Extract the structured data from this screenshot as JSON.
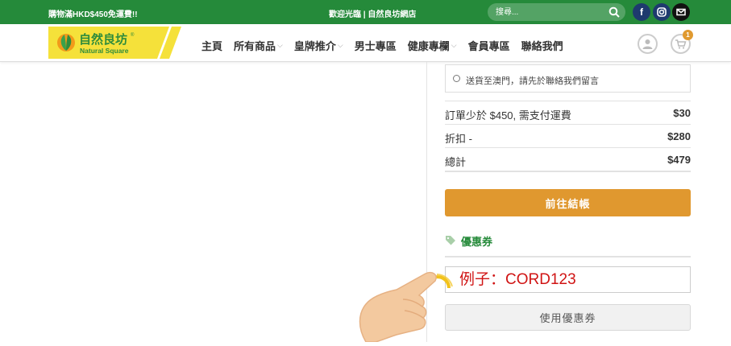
{
  "topbar": {
    "promo": "購物滿HKD$450免運費!!",
    "welcome": "歡迎光臨 | 自然良坊網店",
    "search_placeholder": "搜尋...",
    "search_icon": "search-icon",
    "social": [
      {
        "name": "facebook-icon",
        "glyph": "f",
        "color": "#1e3a6e"
      },
      {
        "name": "instagram-icon",
        "glyph": "◎",
        "color": "#1e3a6e"
      },
      {
        "name": "email-icon",
        "glyph": "✉",
        "color": "#111111"
      }
    ]
  },
  "logo": {
    "chinese": "自然良坊",
    "english": "Natural Square",
    "reg": "®"
  },
  "nav": {
    "items": [
      {
        "label": "主頁"
      },
      {
        "label": "所有商品",
        "dropdown": true
      },
      {
        "label": "皇牌推介",
        "dropdown": true
      },
      {
        "label": "男士專區"
      },
      {
        "label": "健康專欄",
        "dropdown": true
      },
      {
        "label": "會員專區"
      },
      {
        "label": "聯絡我們"
      }
    ],
    "chevron": "⌵"
  },
  "header_icons": {
    "user": "user-icon",
    "cart": "cart-icon",
    "cart_count": "1"
  },
  "cart_totals": {
    "shipping_option": "送貨至澳門，請先於聯絡我們留言",
    "rows": [
      {
        "label": "訂單少於 $450, 需支付運費",
        "value": "$30"
      },
      {
        "label": "折扣 -",
        "value": "$280"
      },
      {
        "label": "總計",
        "value": "$479"
      }
    ],
    "checkout_label": "前往結帳"
  },
  "coupon": {
    "heading": "優惠券",
    "icon": "tag-icon",
    "placeholder": "例子：CORD123",
    "apply_label": "使用優惠券"
  },
  "colors": {
    "brand_green": "#258a3a",
    "accent_orange": "#e0982f",
    "logo_yellow": "#f5e13a",
    "coupon_text_red": "#d01414"
  }
}
